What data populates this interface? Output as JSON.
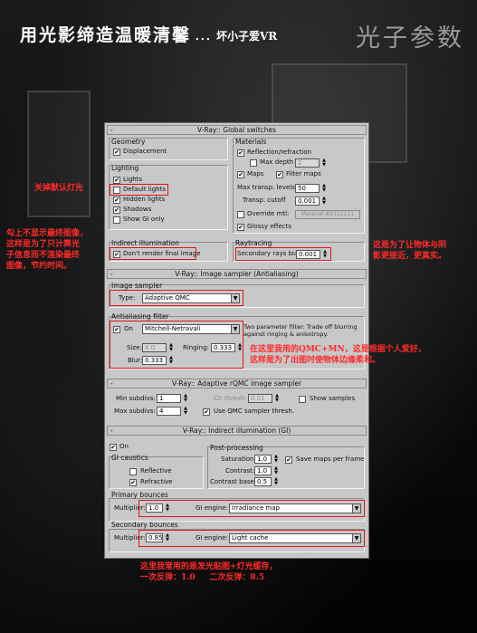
{
  "header": {
    "title": "用光影缔造温暖清馨",
    "subtitle": "．．．坏小子爱VR",
    "logo": "光子参数"
  },
  "global_switches": {
    "title": "V-Ray:: Global switches",
    "geometry": {
      "label": "Geometry",
      "displacement": "Displacement"
    },
    "lighting": {
      "label": "Lighting",
      "lights": "Lights",
      "default_lights": "Default lights",
      "hidden_lights": "Hidden lights",
      "shadows": "Shadows",
      "show_gi_only": "Show GI only"
    },
    "indirect": {
      "label": "Indirect illumination",
      "dont_render": "Don't render final image"
    },
    "materials": {
      "label": "Materials",
      "reflection_refraction": "Reflection/refraction",
      "max_depth": "Max depth",
      "max_depth_value": "2",
      "maps": "Maps",
      "filter_maps": "Filter maps",
      "max_transp_levels": "Max transp. levels",
      "max_transp_value": "50",
      "transp_cutoff": "Transp. cutoff",
      "transp_cutoff_value": "0.001",
      "override_mtl": "Override mtl:",
      "override_button": "Material #2111111",
      "glossy_effects": "Glossy effects"
    },
    "raytracing": {
      "label": "Raytracing",
      "secondary_bias": "Secondary rays bias",
      "secondary_bias_value": "0.001"
    }
  },
  "image_sampler": {
    "title": "V-Ray:: Image sampler (Antialiasing)",
    "group_label": "Image sampler",
    "type_label": "Type:",
    "type_value": "Adaptive QMC",
    "aa_filter_label": "Antialiasing filter",
    "on_label": "On",
    "filter_value": "Mitchell-Netravali",
    "filter_desc": "Two parameter filter: Trade off blurring against ringing & anisotropy.",
    "size_label": "Size:",
    "size_value": "4.0",
    "ringing_label": "Ringing:",
    "ringing_value": "0.333",
    "blur_label": "Blur:",
    "blur_value": "0.333"
  },
  "adaptive_qmc": {
    "title": "V-Ray:: Adaptive rQMC image sampler",
    "min_subdivs_label": "Min subdivs:",
    "min_subdivs_value": "1",
    "max_subdivs_label": "Max subdivs:",
    "max_subdivs_value": "4",
    "clr_thresh_label": "Clr thresh:",
    "clr_thresh_value": "0.01",
    "use_qmc_label": "Use QMC sampler thresh.",
    "show_samples_label": "Show samples"
  },
  "indirect_illumination": {
    "title": "V-Ray:: Indirect illumination (GI)",
    "on_label": "On",
    "gi_caustics_label": "GI caustics",
    "reflective_label": "Reflective",
    "refractive_label": "Refractive",
    "post_processing_label": "Post-processing",
    "saturation_label": "Saturation:",
    "saturation_value": "1.0",
    "contrast_label": "Contrast:",
    "contrast_value": "1.0",
    "contrast_base_label": "Contrast base:",
    "contrast_base_value": "0.5",
    "save_maps_label": "Save maps per frame",
    "primary_label": "Primary bounces",
    "primary_multiplier_label": "Multiplier:",
    "primary_multiplier_value": "1.0",
    "primary_engine_label": "GI engine:",
    "primary_engine_value": "Irradiance map",
    "secondary_label": "Secondary bounces",
    "secondary_multiplier_label": "Multiplier:",
    "secondary_multiplier_value": "0.85",
    "secondary_engine_label": "GI engine:",
    "secondary_engine_value": "Light cache"
  },
  "annotations": {
    "default_lights": "关掉默认灯光",
    "final_image": [
      "勾上不显示最终图像，",
      "这样是为了只计算光",
      "子信息而不渲染最终",
      "图像，节约时间。"
    ],
    "bias": [
      "这是为了让物体与阴",
      "影更接近，更真实。"
    ],
    "filter": [
      "在这里我用的QMC+MN，这是根据个人爱好，",
      "这样是为了出图时使物体边缘柔和。"
    ],
    "gi": [
      "这里我常用的是发光贴图+灯光缓存，",
      "一次反弹：1.0     二次反弹：8.5"
    ]
  },
  "colors": {
    "panel": "#c8c8c8",
    "highlight": "#e01515",
    "annotation": "#ff2a2a"
  }
}
